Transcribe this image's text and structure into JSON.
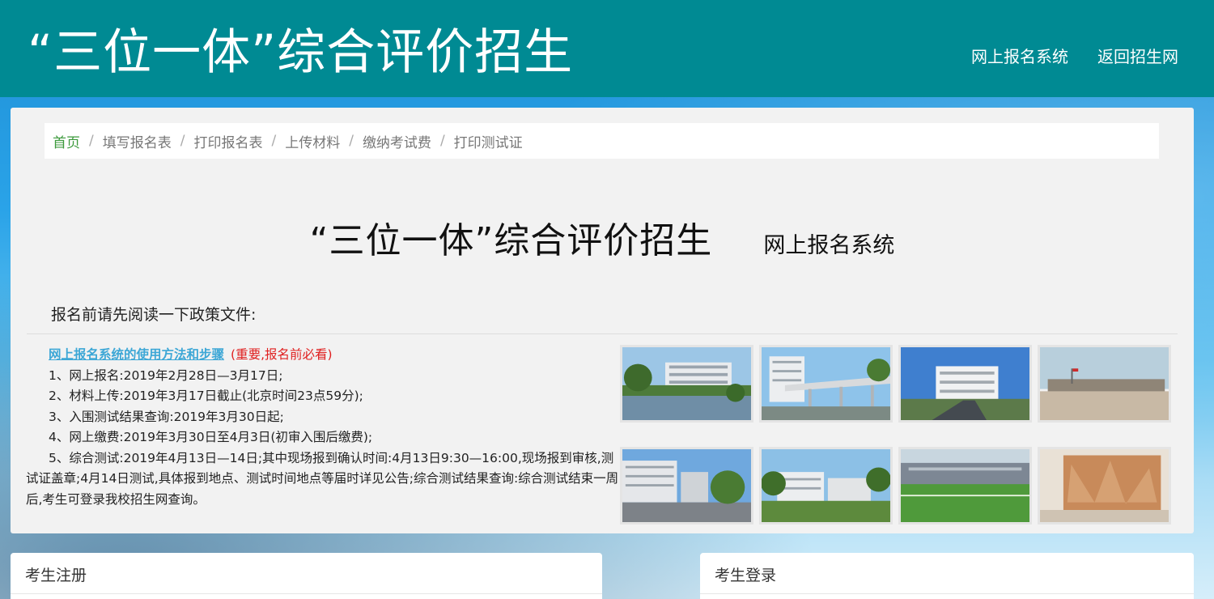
{
  "header": {
    "site_title": "“三位一体”综合评价招生",
    "nav": [
      "网上报名系统",
      "返回招生网"
    ]
  },
  "breadcrumb": [
    "首页",
    "填写报名表",
    "打印报名表",
    "上传材料",
    "缴纳考试费",
    "打印测试证"
  ],
  "breadcrumb_separator": "/",
  "heading": {
    "main": "“三位一体”综合评价招生",
    "sub": "网上报名系统"
  },
  "notice_title": "报名前请先阅读一下政策文件:",
  "guide": {
    "link": "网上报名系统的使用方法和步骤",
    "note": "(重要,报名前必看)"
  },
  "schedule": [
    "1、网上报名:2019年2月28日—3月17日;",
    "2、材料上传:2019年3月17日截止(北京时间23点59分);",
    "3、入围测试结果查询:2019年3月30日起;",
    "4、网上缴费:2019年3月30日至4月3日(初审入围后缴费);",
    "5、综合测试:2019年4月13日—14日;其中现场报到确认时间:4月13日9:30—16:00,现场报到审核,测试证盖章;4月14日测试,具体报到地点、测试时间地点等届时详见公告;综合测试结果查询:综合测试结束一周后,考生可登录我校招生网查询。"
  ],
  "photos": [
    "campus-photo-lake",
    "campus-photo-gate",
    "campus-photo-building",
    "campus-photo-plaza",
    "campus-photo-road",
    "campus-photo-trees",
    "campus-photo-field",
    "campus-photo-mural"
  ],
  "cards": {
    "register": "考生注册",
    "login": "考生登录"
  },
  "colors": {
    "header_bg": "#008a93",
    "link_blue": "#3da7d6",
    "note_red": "#e02020",
    "breadcrumb_active": "#3c9a3c"
  }
}
